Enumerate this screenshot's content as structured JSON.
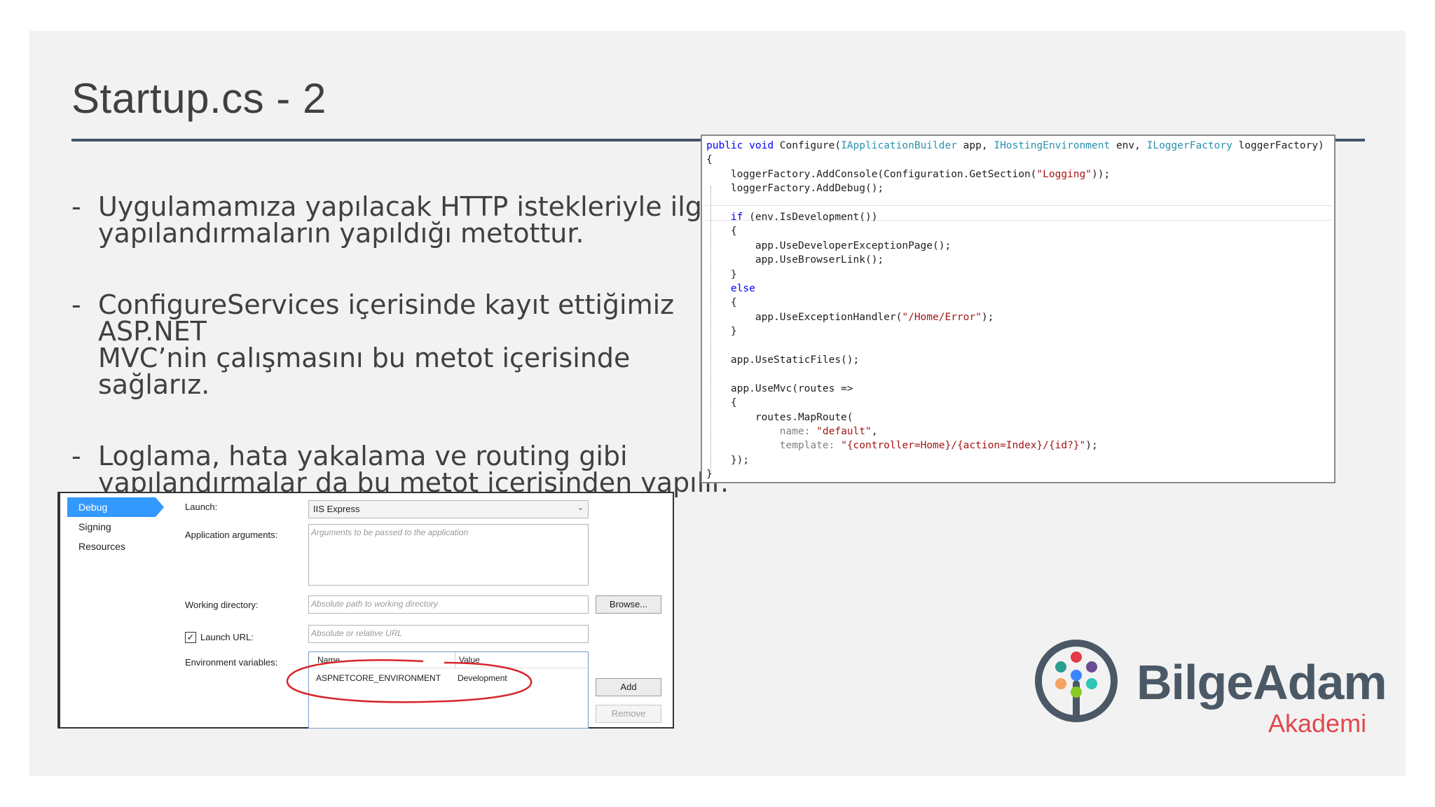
{
  "slide": {
    "title": "Startup.cs - 2",
    "bullets": [
      {
        "dash": "-",
        "lines": [
          "Uygulamamıza yapılacak HTTP istekleriyle ilgili",
          "yapılandırmaların yapıldığı metottur."
        ]
      },
      {
        "dash": "-",
        "lines": [
          "ConfigureServices içerisinde kayıt ettiğimiz ASP.NET",
          "MVC’nin çalışmasını bu metot içerisinde sağlarız."
        ]
      },
      {
        "dash": "-",
        "lines": [
          "Loglama, hata yakalama ve routing gibi",
          "yapılandırmalar da bu metot içerisinden yapılır."
        ]
      }
    ]
  },
  "code": {
    "lines": [
      "public void Configure(IApplicationBuilder app, IHostingEnvironment env, ILoggerFactory loggerFactory)",
      "{",
      "    loggerFactory.AddConsole(Configuration.GetSection(\"Logging\"));",
      "    loggerFactory.AddDebug();",
      "",
      "    if (env.IsDevelopment())",
      "    {",
      "        app.UseDeveloperExceptionPage();",
      "        app.UseBrowserLink();",
      "    }",
      "    else",
      "    {",
      "        app.UseExceptionHandler(\"/Home/Error\");",
      "    }",
      "",
      "    app.UseStaticFiles();",
      "",
      "    app.UseMvc(routes =>",
      "    {",
      "        routes.MapRoute(",
      "            name: \"default\",",
      "            template: \"{controller=Home}/{action=Index}/{id?}\");",
      "    });",
      "}"
    ]
  },
  "dialog": {
    "nav": [
      "Debug",
      "Signing",
      "Resources"
    ],
    "launch_label": "Launch:",
    "launch_value": "IIS Express",
    "app_args_label": "Application arguments:",
    "app_args_placeholder": "Arguments to be passed to the application",
    "working_dir_label": "Working directory:",
    "working_dir_placeholder": "Absolute path to working directory",
    "browse_button": "Browse...",
    "launch_url_label": "Launch URL:",
    "launch_url_checked": true,
    "launch_url_placeholder": "Absolute or relative URL",
    "env_vars_label": "Environment variables:",
    "env_columns": [
      "Name",
      "Value"
    ],
    "env_rows": [
      {
        "name": "ASPNETCORE_ENVIRONMENT",
        "value": "Development"
      }
    ],
    "add_button": "Add",
    "remove_button": "Remove",
    "highlight_color": "#d7262b"
  },
  "logo": {
    "name": "BilgeAdam",
    "subtitle": "Akademi",
    "colors": {
      "ring": "#4b5966",
      "text": "#4b5966",
      "subtitle": "#e0484e",
      "dots": [
        "#e63946",
        "#2a9d8f",
        "#6a4c93",
        "#f4a261",
        "#3a86ff",
        "#2ec4b6",
        "#8ac926"
      ]
    }
  }
}
